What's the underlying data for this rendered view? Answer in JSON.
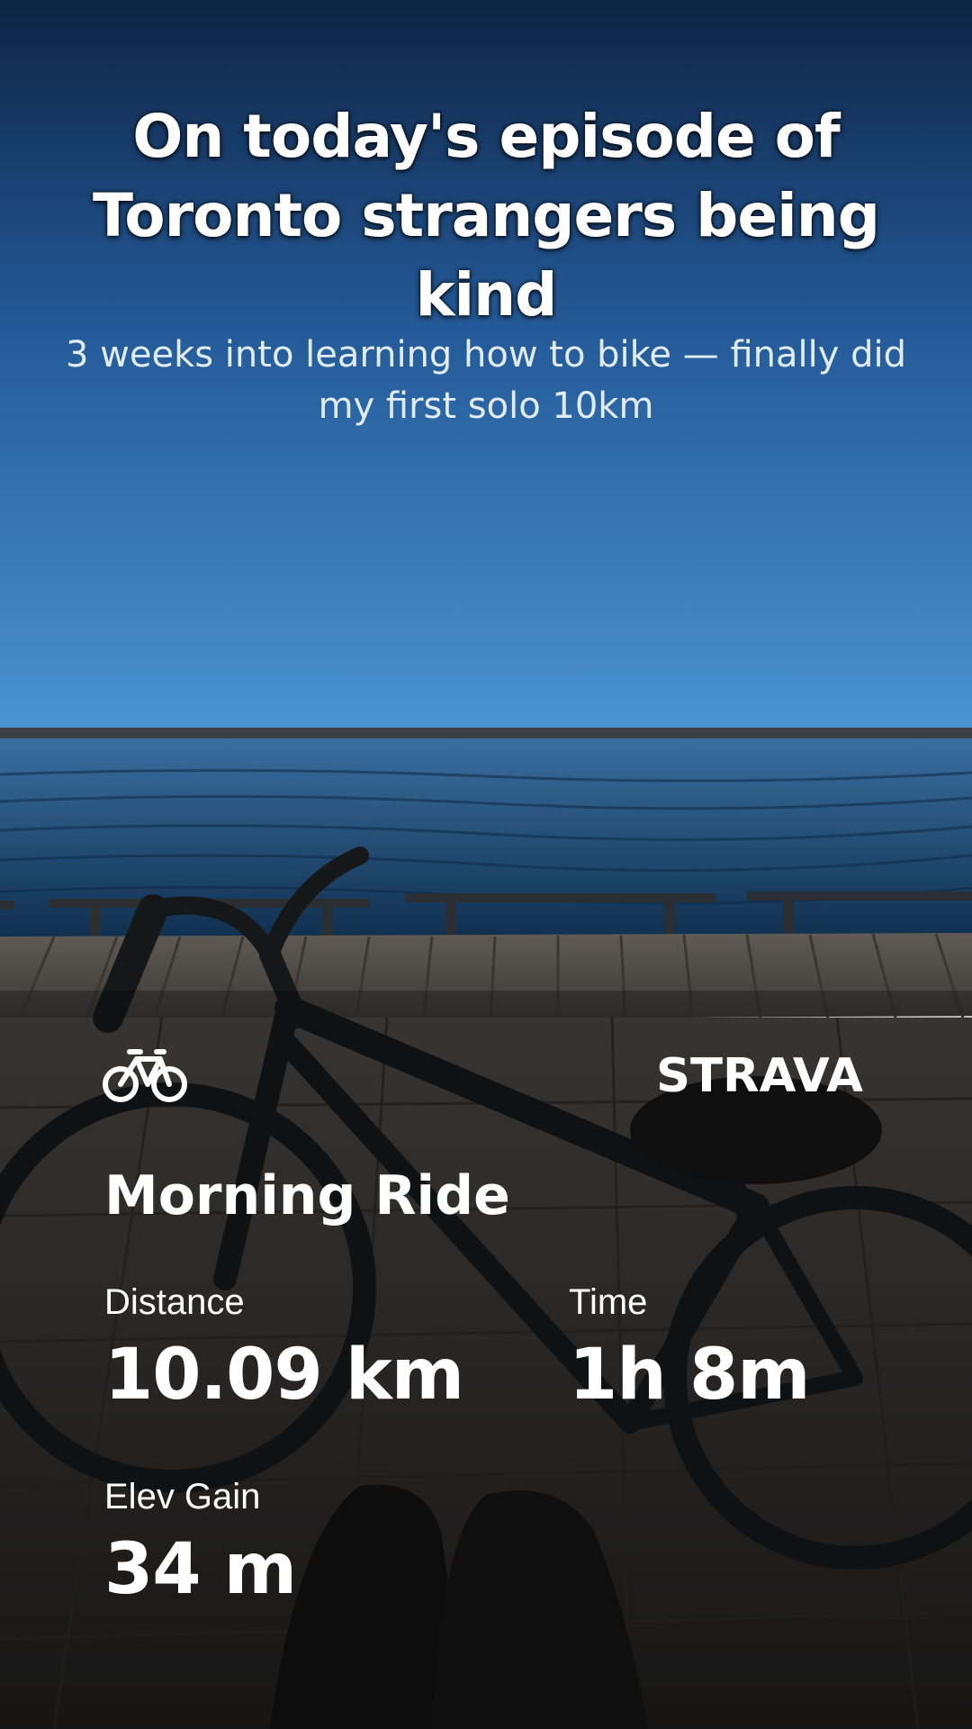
{
  "post": {
    "headline": "On today's episode of Toronto strangers being kind",
    "subline": "3 weeks into learning how to bike — finally did my first solo 10km"
  },
  "activity": {
    "type_icon": "bicycle-icon",
    "brand": "STRAVA",
    "name": "Morning Ride",
    "stats": {
      "distance": {
        "label": "Distance",
        "value": "10.09 km"
      },
      "time": {
        "label": "Time",
        "value": "1h 8m"
      },
      "elev_gain": {
        "label": "Elev Gain",
        "value": "34 m"
      }
    }
  },
  "colors": {
    "sky_top": "#0f2a4d",
    "sky_bottom": "#4b8fd0",
    "water": "#1d4a78",
    "text": "#ffffff"
  }
}
